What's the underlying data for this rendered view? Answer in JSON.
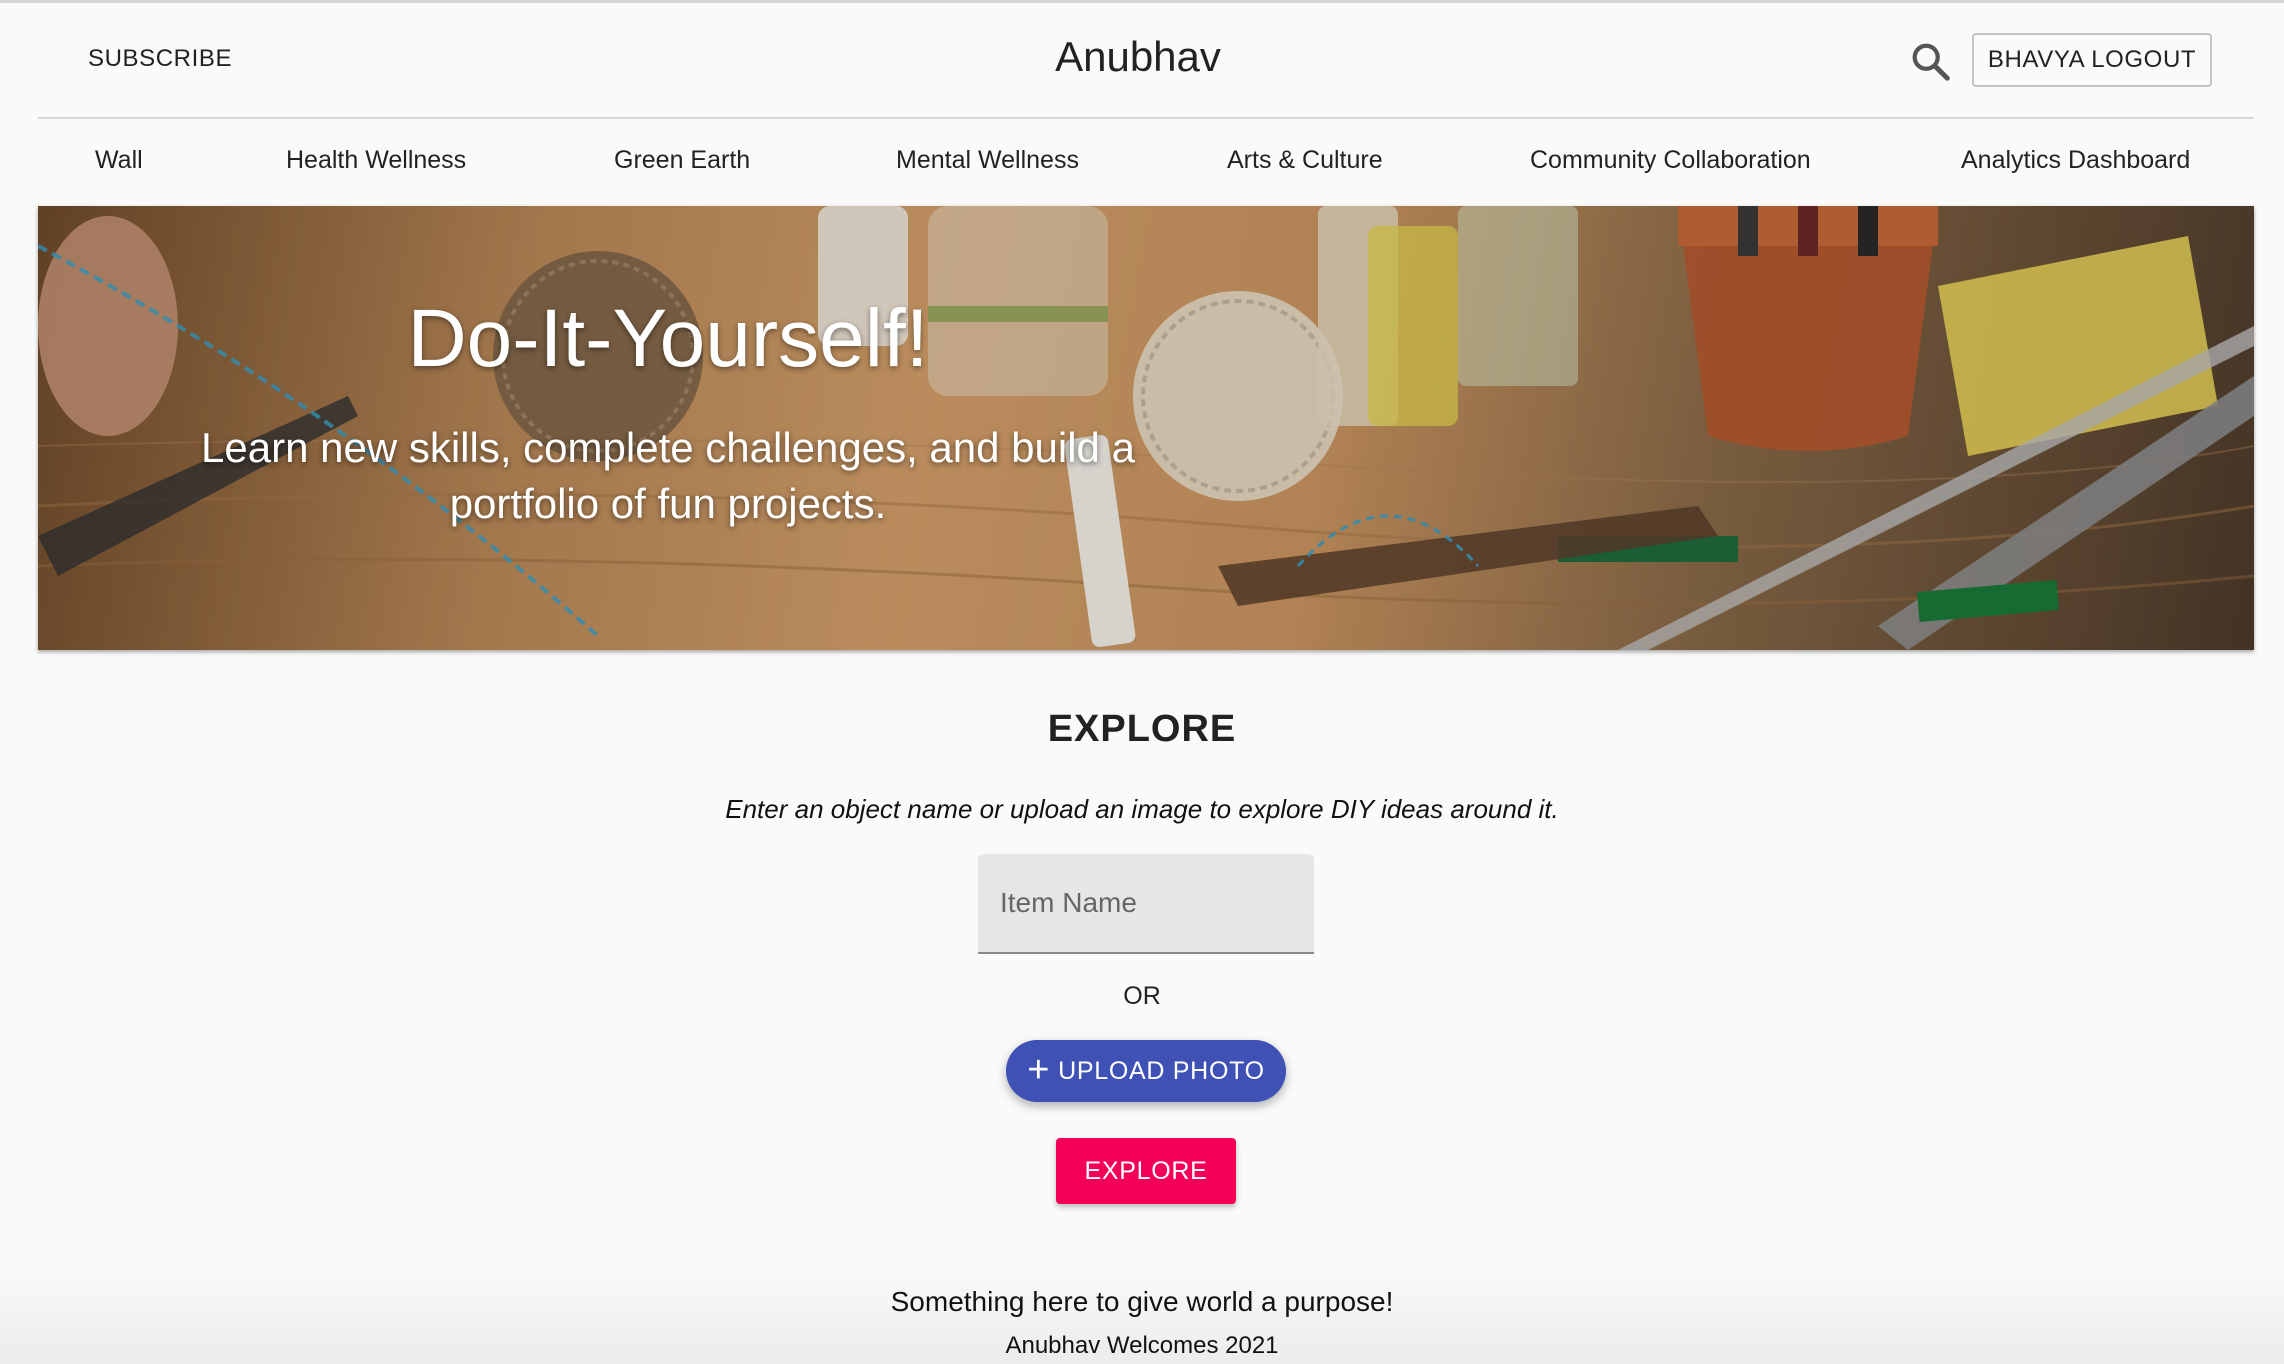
{
  "header": {
    "subscribe_label": "SUBSCRIBE",
    "brand": "Anubhav",
    "logout_label": "BHAVYA LOGOUT"
  },
  "nav": {
    "items": [
      "Wall",
      "Health Wellness",
      "Green Earth",
      "Mental Wellness",
      "Arts & Culture",
      "Community Collaboration",
      "Analytics Dashboard"
    ]
  },
  "hero": {
    "title": "Do-It-Yourself!",
    "subtitle_line1": "Learn new skills, complete challenges, and build a",
    "subtitle_line2": "portfolio of fun projects."
  },
  "explore": {
    "title": "EXPLORE",
    "description": "Enter an object name or upload an image to explore DIY ideas around it.",
    "item_placeholder": "Item Name",
    "or_label": "OR",
    "upload_label": "UPLOAD PHOTO",
    "explore_button_label": "EXPLORE"
  },
  "footer": {
    "line1": "Something here to give world a purpose!",
    "line2": "Anubhav Welcomes 2021"
  },
  "colors": {
    "primary": "#3f51b5",
    "secondary": "#f50057",
    "background": "#fafafa"
  },
  "icons": {
    "search": "search-icon",
    "upload": "plus-icon"
  }
}
